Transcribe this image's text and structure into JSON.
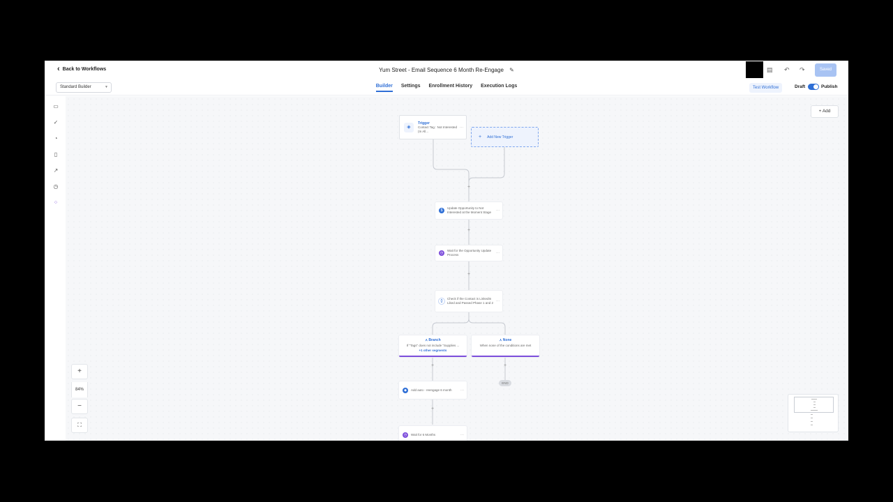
{
  "header": {
    "back_label": "Back to Workflows",
    "title": "Yum Street - Email Sequence 6 Month Re-Engage",
    "save_label": "Saved"
  },
  "toolbar": {
    "builder_select": "Standard Builder",
    "tabs": [
      {
        "label": "Builder",
        "active": true
      },
      {
        "label": "Settings",
        "active": false
      },
      {
        "label": "Enrollment History",
        "active": false
      },
      {
        "label": "Execution Logs",
        "active": false
      }
    ],
    "test_workflow": "Test Workflow",
    "draft_label": "Draft",
    "publish_label": "Publish",
    "publish_toggle_on": true
  },
  "sidebar": {
    "icons": [
      "chat-icon",
      "check-circle-icon",
      "pie-chart-icon",
      "file-icon",
      "external-link-icon",
      "clock-icon",
      "workflow-icon"
    ]
  },
  "canvas": {
    "add_label": "Add",
    "trigger": {
      "label": "Trigger",
      "desc": "Contact Tag : Not Interested (In All..."
    },
    "add_trigger": "Add New Trigger",
    "steps": [
      {
        "text": "Update Opportunity to Not Interested at the Moment Stage",
        "icon_color": "#2f6fd6"
      },
      {
        "text": "Wait for the Opportunity Update Process",
        "icon_color": "#7c4ddb"
      },
      {
        "text": "Check if the Contact is LinkedIn Liked and Passed Phase 1 and 2",
        "icon_color": "#ffffff"
      }
    ],
    "branch_left": {
      "label": "Branch",
      "desc": "If \"Tags\" does not include \"Supplies ...",
      "sub": "+1 other segments"
    },
    "branch_right": {
      "label": "None",
      "desc": "When none of the conditions are met"
    },
    "end_label": "END",
    "lower_steps": [
      {
        "text": "Add auto - reengage 6 month",
        "icon_color": "#2f6fd6"
      },
      {
        "text": "Wait for 6 Months",
        "icon_color": "#7c4ddb"
      }
    ],
    "zoom_level": "84%"
  },
  "colors": {
    "accent": "#2f6fd6",
    "branch": "#7c4ddb",
    "canvas_bg": "#f6f7f9"
  }
}
